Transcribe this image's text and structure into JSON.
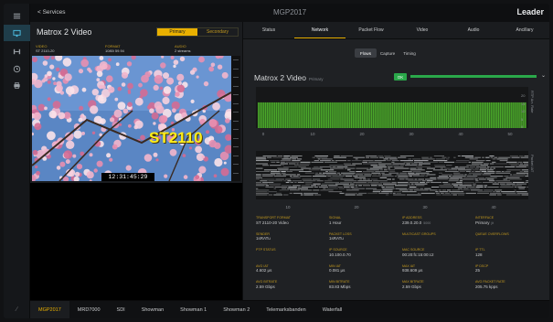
{
  "window": {
    "back_label": "< Services",
    "title": "MGP2017",
    "brand": "Leader"
  },
  "sidebar": {
    "icons": [
      "menu-icon",
      "monitor-icon",
      "network-icon",
      "clock-icon",
      "printer-icon"
    ],
    "foot_icon": "ruler-icon"
  },
  "left": {
    "title": "Matrox 2 Video",
    "toggle": {
      "primary": "Primary",
      "secondary": "Secondary"
    },
    "info": [
      {
        "k": "VIDEO",
        "v": "ST 2110-20"
      },
      {
        "k": "FORMAT",
        "v": "1080i 59.94"
      },
      {
        "k": "AUDIO",
        "v": "2 streams"
      }
    ],
    "video_label": "ST2110",
    "timecode": "12:31:45:29"
  },
  "tabs": [
    "Status",
    "Network",
    "Packet Flow",
    "Video",
    "Audio",
    "Ancillary"
  ],
  "active_tab": 1,
  "subtabs": [
    "Flows",
    "Capture",
    "Timing"
  ],
  "active_subtab": 0,
  "stream": {
    "title": "Matrox 2 Video",
    "subtitle": "Primary",
    "status": "OK"
  },
  "chart_data": [
    {
      "type": "bar",
      "title": "",
      "xlabel": "",
      "ylabel": "",
      "ylim": [
        0,
        20
      ],
      "yticks": [
        "20",
        "15",
        "10",
        "5",
        "0"
      ],
      "xticks": [
        "0",
        "10",
        "20",
        "30",
        "40",
        "50"
      ],
      "side_label": "RTP Arr. Rate",
      "bar_count": 150,
      "level": 0.78,
      "color": "#4aa82a"
    },
    {
      "type": "heatmap",
      "title": "",
      "xticks": [
        "10",
        "20",
        "30",
        "40"
      ],
      "side_label": "Packet IAT",
      "color": "#b0b3b6"
    }
  ],
  "stats": [
    {
      "k": "TRANSPORT FORMAT",
      "v": "ST 2110-20 Video",
      "u": ""
    },
    {
      "k": "SIGNAL",
      "v": "1 Hour",
      "u": ""
    },
    {
      "k": "IP ADDRESS",
      "v": "239.0.20.0",
      "u": "5000"
    },
    {
      "k": "INTERFACE",
      "v": "Primary",
      "u": "jit"
    },
    {
      "k": "SENDER",
      "v": "1sRATu",
      "u": ""
    },
    {
      "k": "PACKET LOSS",
      "v": "1sRATu",
      "u": ""
    },
    {
      "k": "MULTICAST GROUPS",
      "v": "",
      "u": ""
    },
    {
      "k": "QUEUE OVERFLOWS",
      "v": "",
      "u": ""
    },
    {
      "k": "PTP STATUS",
      "v": "",
      "u": ""
    },
    {
      "k": "IP SOURCE",
      "v": "10.100.0.70",
      "u": ""
    },
    {
      "k": "MAC SOURCE",
      "v": "00:20:fc:15:00:c2",
      "u": ""
    },
    {
      "k": "IP TTL",
      "v": "128",
      "u": ""
    },
    {
      "k": "AVG IAT",
      "v": "4.602 μs",
      "u": ""
    },
    {
      "k": "MIN IAT",
      "v": "0.081 μs",
      "u": ""
    },
    {
      "k": "MAX IAT",
      "v": "938.609 μs",
      "u": ""
    },
    {
      "k": "IP DSCP",
      "v": "25",
      "u": ""
    },
    {
      "k": "AVG BITRATE",
      "v": "2.59 Gbps",
      "u": ""
    },
    {
      "k": "MIN BITRATE",
      "v": "83.83 Mbps",
      "u": ""
    },
    {
      "k": "MAX BITRATE",
      "v": "2.59 Gbps",
      "u": ""
    },
    {
      "k": "AVG PACKET RATE",
      "v": "205.75 kpps",
      "u": ""
    }
  ],
  "bottom_tabs": [
    "MGP2017",
    "MRD7000",
    "SDI",
    "Showman",
    "Showman 1",
    "Showman 2",
    "Telemarksbanden",
    "Waterfall"
  ],
  "active_bottom": 0
}
